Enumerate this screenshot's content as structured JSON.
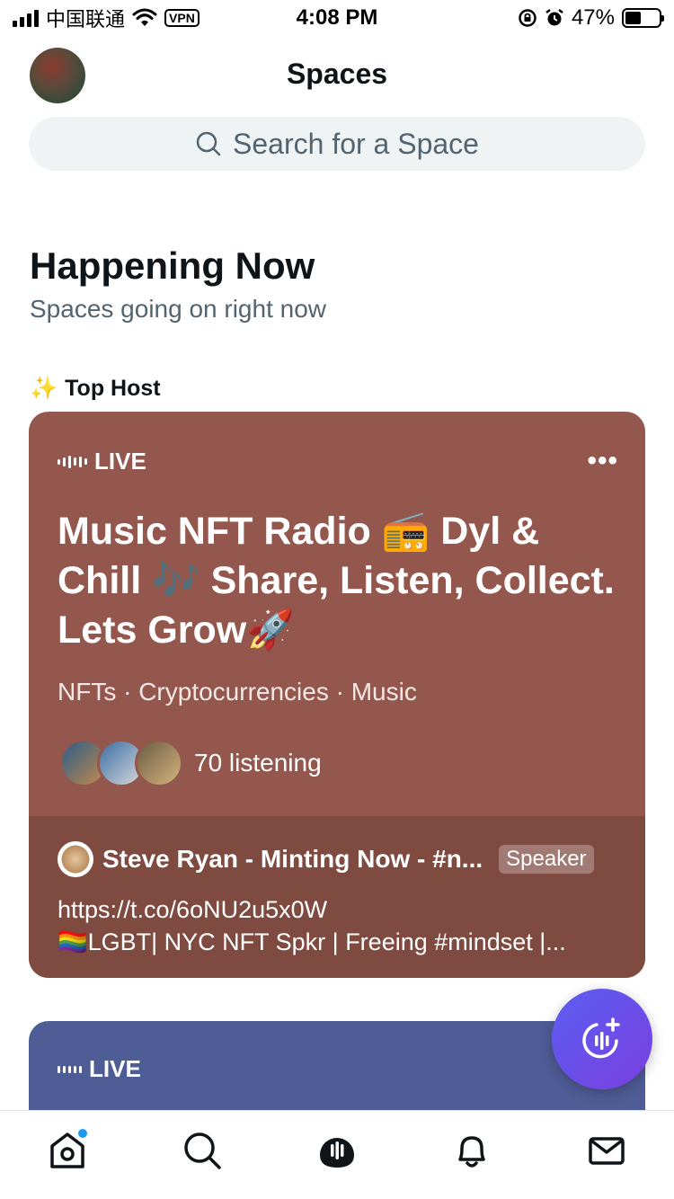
{
  "status_bar": {
    "carrier": "中国联通",
    "vpn": "VPN",
    "time": "4:08 PM",
    "battery": "47%"
  },
  "header": {
    "title": "Spaces",
    "search_placeholder": "Search for a Space"
  },
  "section": {
    "title": "Happening Now",
    "subtitle": "Spaces going on right now",
    "top_host_label": "Top Host",
    "top_host_icon": "✨"
  },
  "card1": {
    "live_label": "LIVE",
    "more": "•••",
    "title": "Music NFT Radio 📻 Dyl & Chill 🎶 Share, Listen, Collect. Lets Grow🚀",
    "topics": "NFTs · Cryptocurrencies · Music",
    "listening": "70 listening",
    "speaker_name": "Steve Ryan - Minting Now - #n...",
    "speaker_badge": "Speaker",
    "speaker_bio_line1": "https://t.co/6oNU2u5x0W",
    "speaker_bio_line2": "🏳️‍🌈LGBT| NYC NFT Spkr | Freeing #mindset |..."
  },
  "card2": {
    "live_label": "LIVE"
  },
  "colors": {
    "card1_bg": "#93574d",
    "card1_footer": "#7f4a40",
    "card2_bg": "#4f5d96",
    "fab_start": "#5b5ef2",
    "fab_end": "#7b3fe0",
    "notification_dot": "#1d9bf0"
  },
  "tabbar": {
    "items": [
      "home-icon",
      "search-icon",
      "spaces-icon",
      "notifications-icon",
      "messages-icon"
    ]
  }
}
